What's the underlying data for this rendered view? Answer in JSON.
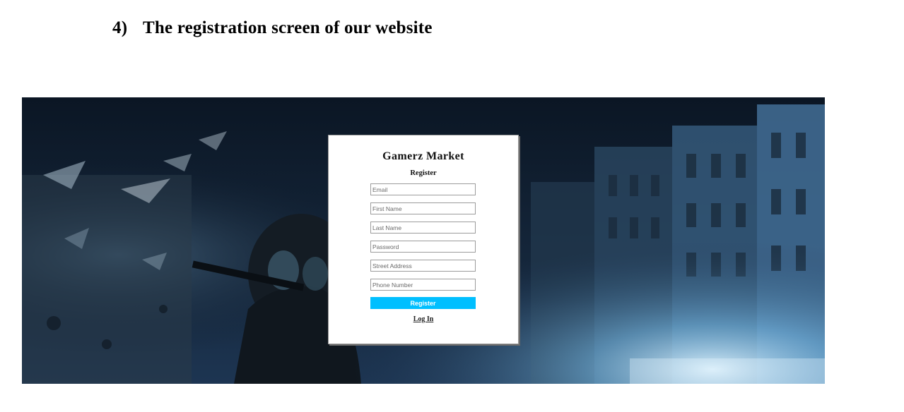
{
  "document": {
    "section_number": "4)",
    "heading": "The registration screen of our website"
  },
  "app": {
    "site_title": "Gamerz Market",
    "form_title": "Register"
  },
  "form": {
    "fields": [
      {
        "placeholder": "Email"
      },
      {
        "placeholder": "First Name"
      },
      {
        "placeholder": "Last Name"
      },
      {
        "placeholder": "Password"
      },
      {
        "placeholder": "Street Address"
      },
      {
        "placeholder": "Phone Number"
      }
    ],
    "submit_label": "Register",
    "login_link": "Log In"
  },
  "colors": {
    "accent_button": "#00bfff",
    "panel_background": "#ffffff"
  }
}
